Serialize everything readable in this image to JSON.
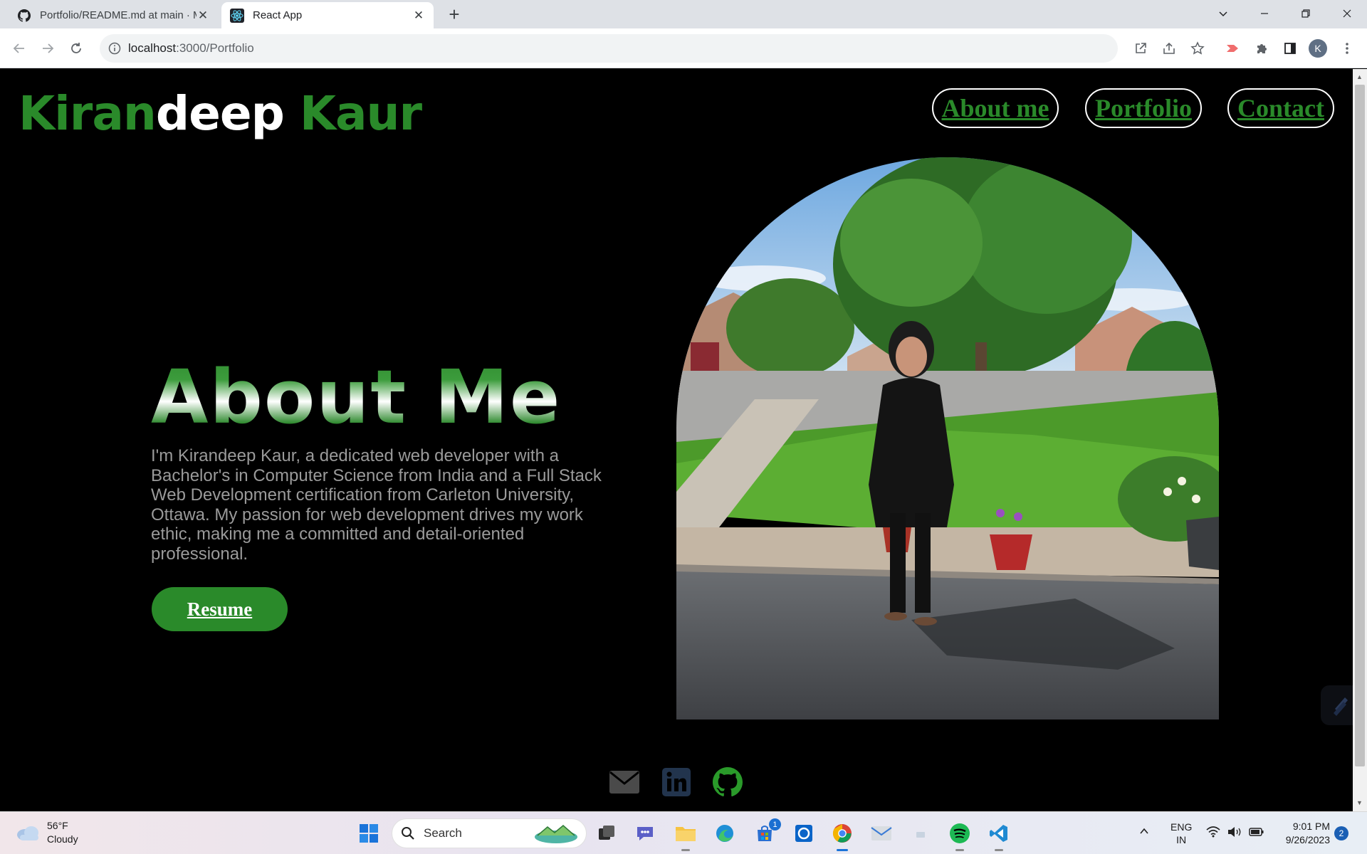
{
  "browser": {
    "tabs": [
      {
        "label": "Portfolio/README.md at main · M",
        "active": false
      },
      {
        "label": "React App",
        "active": true
      }
    ],
    "url_host": "localhost",
    "url_path": ":3000/Portfolio",
    "profile_initial": "K"
  },
  "header": {
    "brand_part1": "Kiran",
    "brand_part2": "deep",
    "brand_part3": "Kaur",
    "nav": [
      "About me",
      "Portfolio",
      "Contact"
    ]
  },
  "about": {
    "title": "About Me",
    "paragraph": "I'm Kirandeep Kaur, a dedicated web developer with a Bachelor's in Computer Science from India and a Full Stack Web Development certification from Carleton University, Ottawa. My passion for web development drives my work ethic, making me a committed and detail-oriented professional.",
    "resume_label": "Resume"
  },
  "social": [
    "email-icon",
    "linkedin-icon",
    "github-icon"
  ],
  "colors": {
    "brand_green": "#2a8a2a",
    "page_bg": "#000000"
  },
  "taskbar": {
    "temperature": "56°F",
    "condition": "Cloudy",
    "search_label": "Search",
    "store_badge": "1",
    "lang_line1": "ENG",
    "lang_line2": "IN",
    "time": "9:01 PM",
    "date": "9/26/2023",
    "notifications": "2"
  }
}
